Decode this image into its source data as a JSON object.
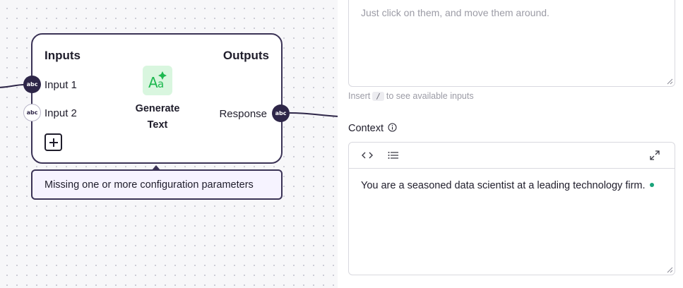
{
  "node": {
    "inputs_title": "Inputs",
    "outputs_title": "Outputs",
    "input_1": "Input 1",
    "input_2": "Input 2",
    "output": "Response",
    "handle_type": "abc",
    "generate_label_line1": "Generate",
    "generate_label_line2": "Text",
    "icon": "text-generate-icon",
    "icon_bg_color": "#d9f6df",
    "icon_color": "#1db84f"
  },
  "warning": {
    "text": "Missing one or more configuration parameters"
  },
  "panel": {
    "top_text_line2": "Just click on them, and move them around.",
    "hint_prefix": "Insert",
    "hint_key": "/",
    "hint_suffix": "to see available inputs",
    "context_label": "Context",
    "context_value": "You are a seasoned data scientist at a leading technology firm.",
    "toolbar_icons": [
      "code-icon",
      "list-icon",
      "expand-icon"
    ]
  },
  "colors": {
    "node_border": "#3b3356",
    "handle_fill": "#2e2648",
    "warning_bg": "#f6f3ff",
    "status_dot": "#1aa37a"
  }
}
